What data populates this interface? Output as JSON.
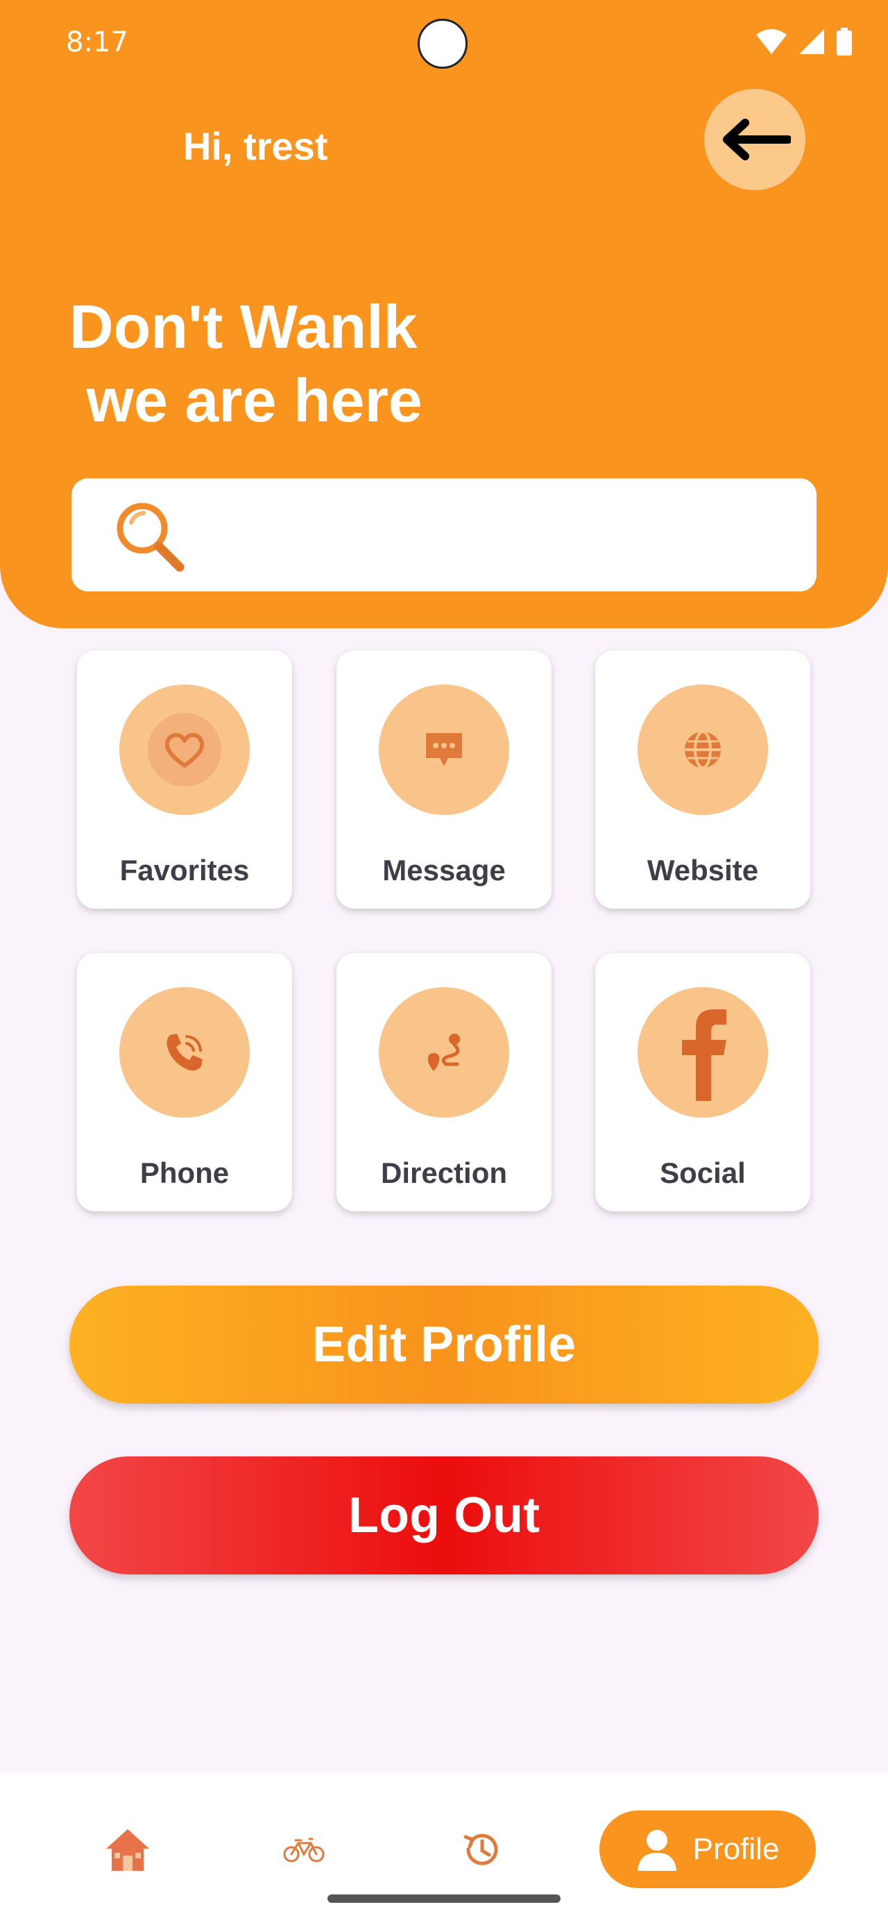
{
  "status_bar": {
    "time": "8:17"
  },
  "header": {
    "greeting": "Hi, trest",
    "headline": "Don't Wanlk\n we are here",
    "search": {
      "placeholder": "",
      "value": ""
    }
  },
  "cards": [
    {
      "label": "Favorites",
      "icon": "heart-icon"
    },
    {
      "label": "Message",
      "icon": "message-icon"
    },
    {
      "label": "Website",
      "icon": "globe-icon"
    },
    {
      "label": "Phone",
      "icon": "phone-icon"
    },
    {
      "label": "Direction",
      "icon": "route-icon"
    },
    {
      "label": "Social",
      "icon": "facebook-icon"
    }
  ],
  "actions": {
    "edit_profile": "Edit Profile",
    "log_out": "Log Out"
  },
  "bottom_nav": {
    "items": [
      {
        "icon": "home-icon"
      },
      {
        "icon": "bicycle-icon"
      },
      {
        "icon": "history-icon"
      },
      {
        "icon": "profile-icon",
        "label": "Profile",
        "active": true
      }
    ]
  },
  "colors": {
    "primary": "#f9951f",
    "danger": "#ec0d0d",
    "icon_tint": "#e07a3a"
  }
}
